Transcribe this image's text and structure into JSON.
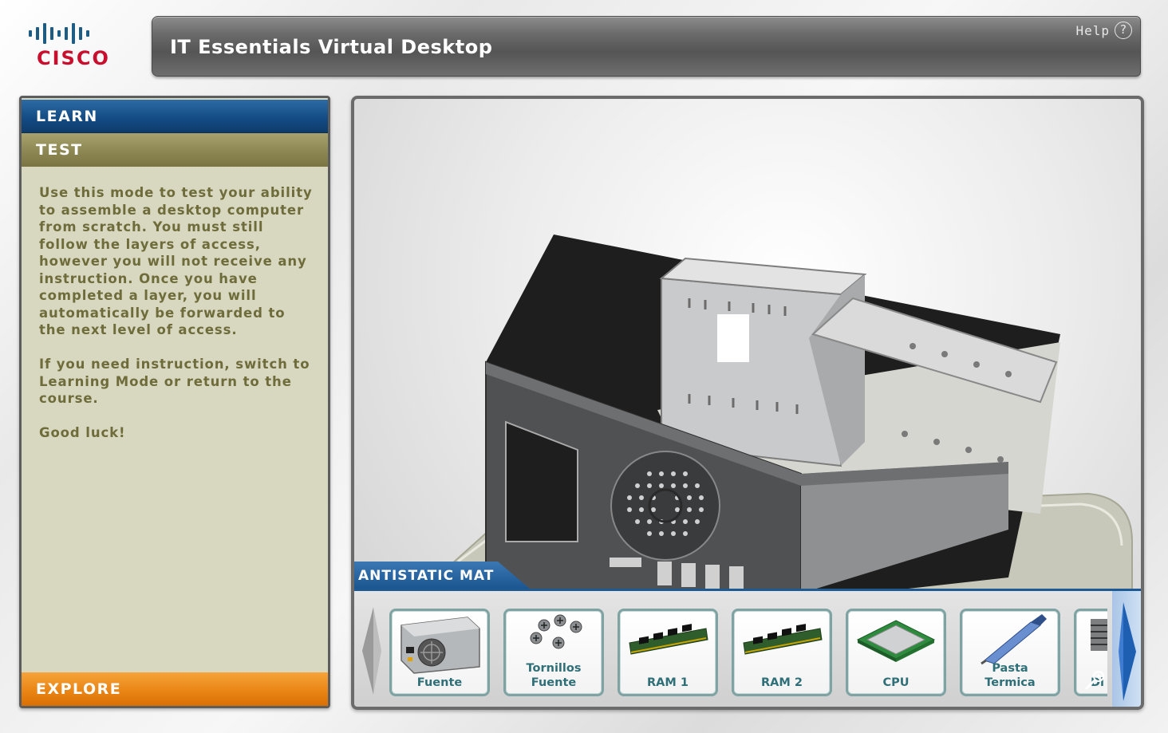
{
  "header": {
    "title": "IT Essentials Virtual Desktop",
    "help_label": "Help",
    "help_icon": "?"
  },
  "logo": {
    "text": "CISCO"
  },
  "left_panel": {
    "tabs": {
      "learn": "LEARN",
      "test": "TEST",
      "explore": "EXPLORE"
    },
    "description": [
      "Use this mode to test your ability to assemble a desktop computer from scratch. You must still follow the layers of access, however you will not receive any instruction. Once you have completed a layer, you will automatically be forwarded to the next level of access.",
      "If you need instruction, switch to Learning Mode or return to the course.",
      "Good luck!"
    ]
  },
  "viewport": {
    "section_label": "ANTISTATIC MAT",
    "items": [
      {
        "label": "Fuente",
        "icon": "power-supply-icon"
      },
      {
        "label": "Tornillos Fuente",
        "icon": "screws-icon"
      },
      {
        "label": "RAM 1",
        "icon": "ram-icon"
      },
      {
        "label": "RAM 2",
        "icon": "ram-icon"
      },
      {
        "label": "CPU",
        "icon": "cpu-icon"
      },
      {
        "label": "Pasta Termica",
        "icon": "thermal-paste-icon"
      },
      {
        "label": "Di",
        "icon": "heatsink-icon"
      }
    ]
  },
  "colors": {
    "learn": "#134a82",
    "test": "#8a8550",
    "explore": "#e88312",
    "cisco_red": "#c8102e",
    "panel_bg": "#d8d8c1",
    "item_text": "#2f6f78"
  }
}
